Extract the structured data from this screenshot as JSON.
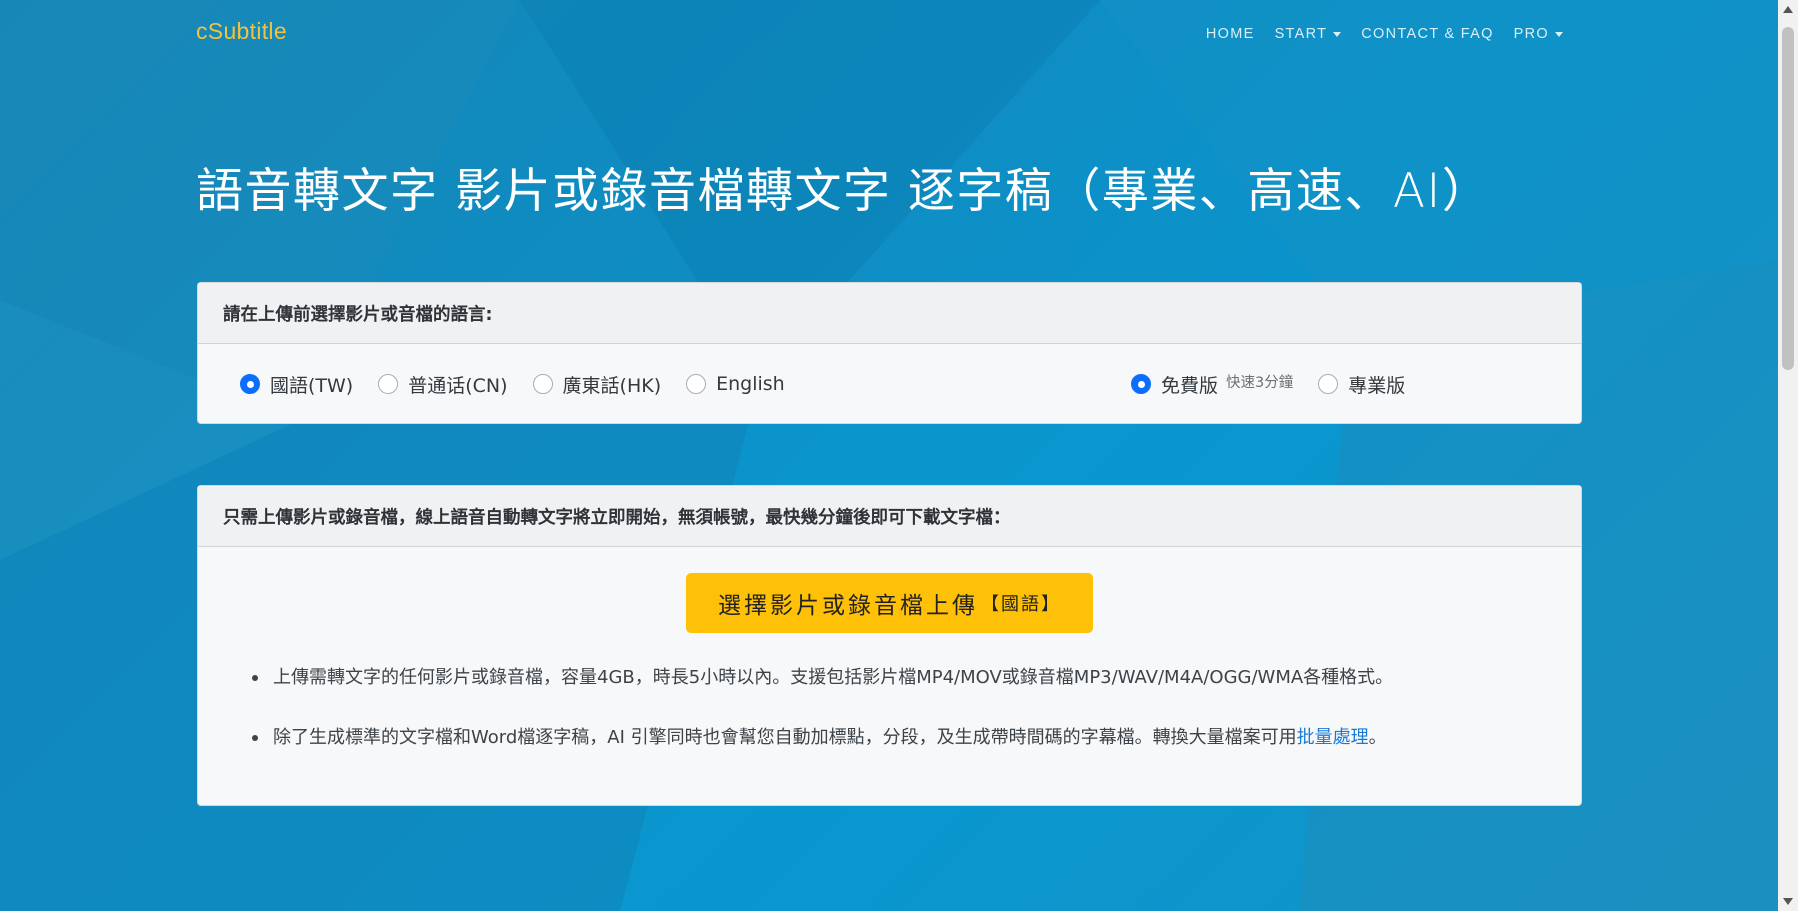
{
  "nav": {
    "brand": "cSubtitle",
    "items": [
      {
        "label": "HOME",
        "dropdown": false
      },
      {
        "label": "START",
        "dropdown": true
      },
      {
        "label": "CONTACT & FAQ",
        "dropdown": false
      },
      {
        "label": "PRO",
        "dropdown": true
      }
    ]
  },
  "headline": "語音轉文字 影片或錄音檔轉文字 逐字稿（專業、高速、AI）",
  "language_card": {
    "header": "請在上傳前選擇影片或音檔的語言:",
    "languages": [
      {
        "label": "國語(TW)",
        "checked": true
      },
      {
        "label": "普通话(CN)",
        "checked": false
      },
      {
        "label": "廣東話(HK)",
        "checked": false
      },
      {
        "label": "English",
        "checked": false
      }
    ],
    "plans": [
      {
        "label": "免費版",
        "note": "快速3分鐘",
        "checked": true
      },
      {
        "label": "專業版",
        "note": "",
        "checked": false
      }
    ]
  },
  "upload_card": {
    "header": "只需上傳影片或錄音檔，線上語音自動轉文字將立即開始，無須帳號，最快幾分鐘後即可下載文字檔：",
    "button_label": "選擇影片或錄音檔上傳",
    "button_tag": "【國語】",
    "bullet1": "上傳需轉文字的任何影片或錄音檔，容量4GB，時長5小時以內。支援包括影片檔MP4/MOV或錄音檔MP3/WAV/M4A/OGG/WMA各種格式。",
    "bullet2_text": "除了生成標準的文字檔和Word檔逐字稿，AI 引擎同時也會幫您自動加標點，分段，及生成帶時間碼的字幕檔。轉換大量檔案可用",
    "bullet2_link": "批量處理",
    "bullet2_end": "。"
  },
  "colors": {
    "brand": "#f3c23d",
    "background": "#0f8dc3",
    "button": "#ffc107",
    "radio_checked": "#0d6efd",
    "link": "#1a7ad8"
  }
}
